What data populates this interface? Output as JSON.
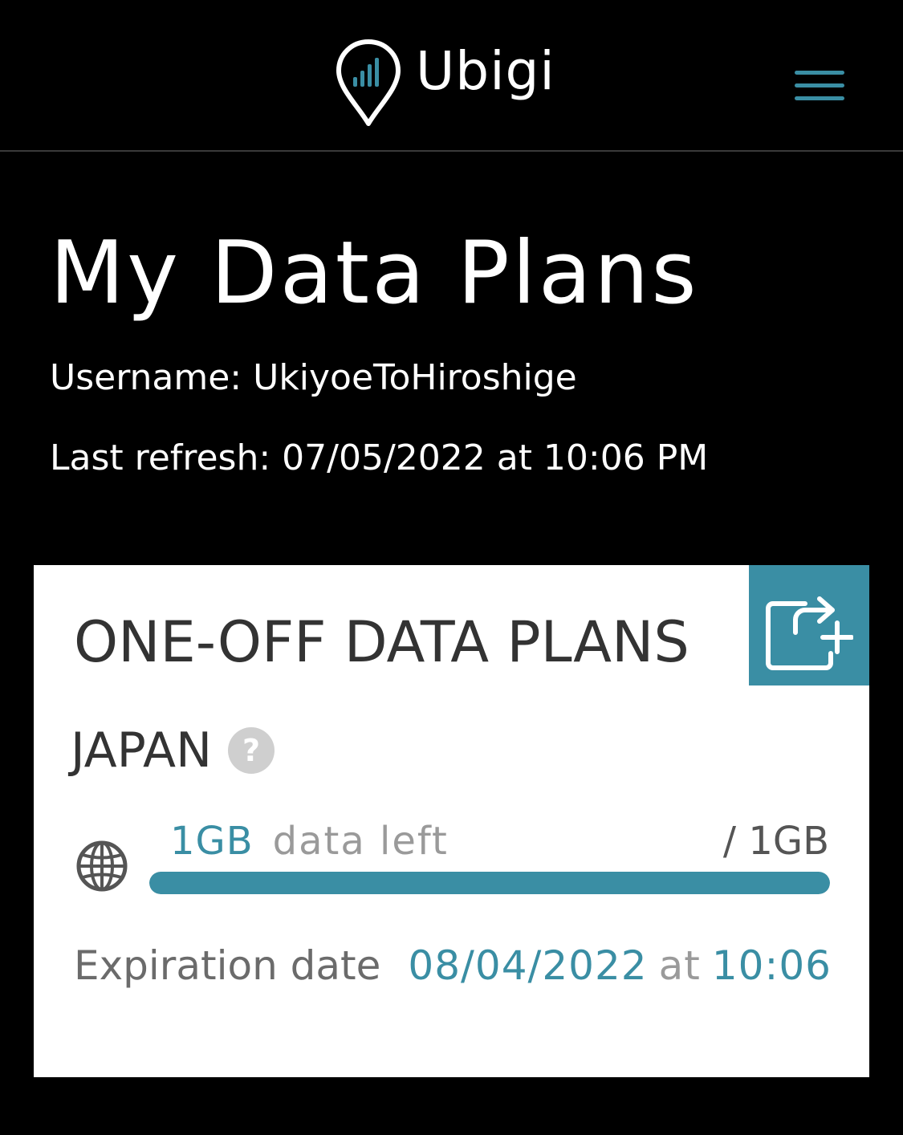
{
  "header": {
    "brand": "Ubigi",
    "menu_icon": "hamburger-menu-icon",
    "logo_icon": "location-pin-signal-icon"
  },
  "page": {
    "title": "My Data Plans",
    "username_line": "Username: UkiyoeToHiroshige",
    "last_refresh_line": "Last refresh: 07/05/2022 at 10:06 PM"
  },
  "card": {
    "title": "ONE-OFF DATA PLANS",
    "action_icon": "share-add-icon",
    "plan": {
      "country": "JAPAN",
      "help_icon": "?",
      "data_left_amount": "1GB",
      "data_left_label": "data left",
      "data_total": "/ 1GB",
      "progress_fraction": 1.0,
      "expiration_label": "Expiration date",
      "expiration_date": "08/04/2022",
      "expiration_at": "at",
      "expiration_time": "10:06"
    }
  },
  "colors": {
    "accent": "#3a8ea4",
    "background": "#000000",
    "card_background": "#ffffff",
    "muted_text": "#9a9a9a"
  }
}
